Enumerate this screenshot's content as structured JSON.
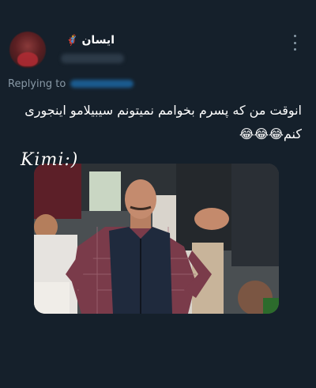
{
  "tweet": {
    "display_name": "ایسان",
    "badge_emoji": "🦸",
    "replying_label": "Replying to",
    "text": "انوقت من که پسرم بخوامم نمیتونم سیبیلامو اینجوری کنم😂😂😂",
    "watermark": "Kimi:)"
  },
  "icons": {
    "more": "more-options-icon",
    "avatar": "avatar"
  },
  "colors": {
    "background": "#15202b",
    "secondary_text": "#8899a6",
    "link": "#1d9bf0"
  }
}
